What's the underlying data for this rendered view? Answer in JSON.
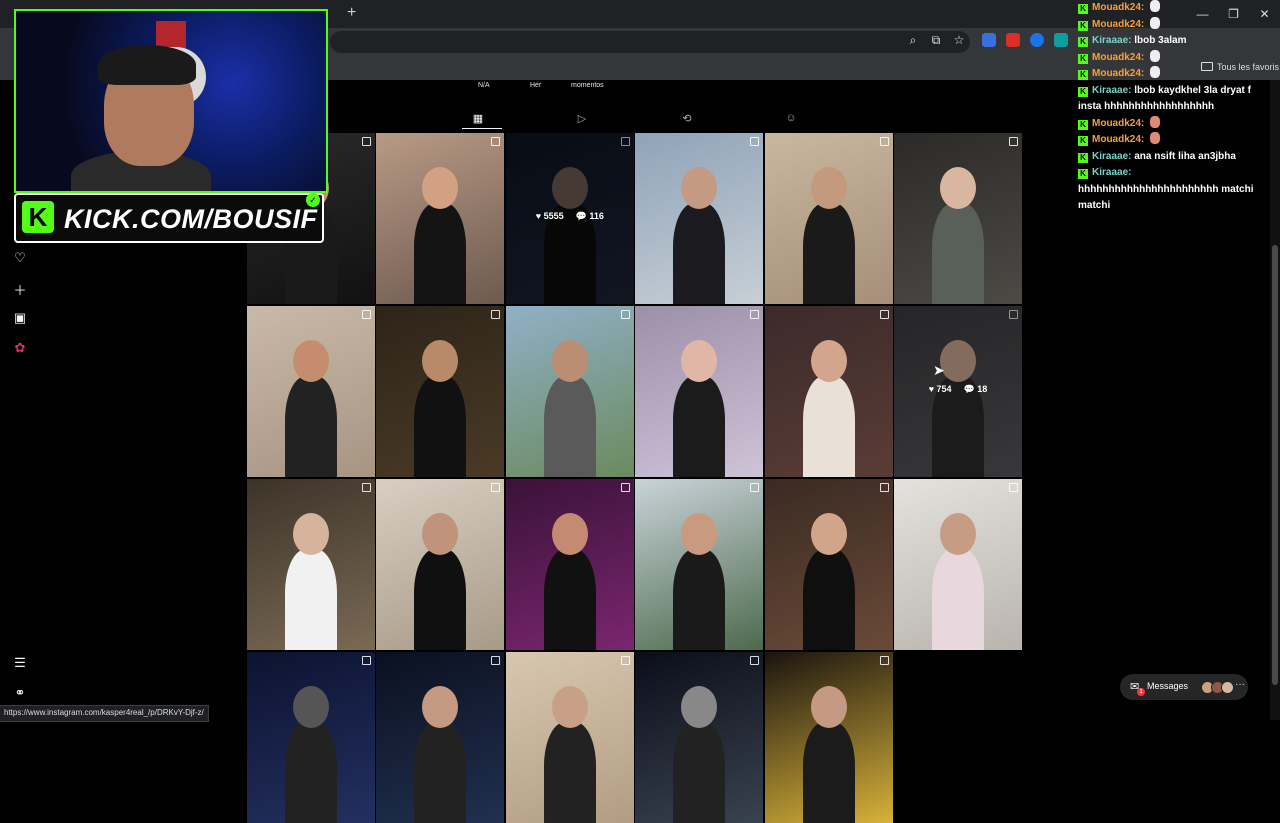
{
  "browser": {
    "tab_close": "×",
    "new_tab": "+",
    "window_controls": [
      "—",
      "❐",
      "✕"
    ],
    "bookmark_folder": "Tous les favoris",
    "extension_icons": [
      "blue",
      "red",
      "blue-circle",
      "teal"
    ]
  },
  "profile": {
    "highlights": [
      "N/A",
      "Her",
      "momentos"
    ],
    "tabs": [
      "grid-icon",
      "reels-icon",
      "reposts-icon",
      "tagged-icon"
    ],
    "active_tab": "grid-icon"
  },
  "posts": [
    {
      "stats": null
    },
    {
      "stats": null
    },
    {
      "stats": {
        "likes": "5555",
        "comments": "116"
      }
    },
    {
      "stats": null
    },
    {
      "stats": null
    },
    {
      "stats": null
    },
    {
      "stats": null
    },
    {
      "stats": null
    },
    {
      "stats": null
    },
    {
      "stats": null
    },
    {
      "stats": null
    },
    {
      "stats": {
        "likes": "754",
        "comments": "18"
      }
    },
    {
      "stats": null
    },
    {
      "stats": null
    },
    {
      "stats": null
    },
    {
      "stats": null
    },
    {
      "stats": null
    },
    {
      "stats": null
    },
    {
      "stats": null
    },
    {
      "stats": null
    },
    {
      "stats": null
    },
    {
      "stats": null
    },
    {
      "stats": null
    }
  ],
  "messages_button": {
    "label": "Messages",
    "badge": "1"
  },
  "status_url": "https://www.instagram.com/kasper4real_/p/DRKvY-Djf-z/",
  "overlay": {
    "banner_text": "KICK.COM/BOUSIF",
    "chat": [
      {
        "user": "Mouadk24",
        "color": "orange",
        "text": "",
        "emote": "white"
      },
      {
        "user": "Mouadk24",
        "color": "orange",
        "text": "",
        "emote": "white"
      },
      {
        "user": "Kiraaae",
        "color": "teal",
        "text": "lbob 3alam",
        "emote": ""
      },
      {
        "user": "Mouadk24",
        "color": "orange",
        "text": "",
        "emote": "white"
      },
      {
        "user": "Mouadk24",
        "color": "orange",
        "text": "",
        "emote": "white"
      },
      {
        "user": "Kiraaae",
        "color": "teal",
        "text": "lbob kaydkhel 3la dryat f insta hhhhhhhhhhhhhhhhhh",
        "emote": ""
      },
      {
        "user": "Mouadk24",
        "color": "orange",
        "text": "",
        "emote": "red"
      },
      {
        "user": "Mouadk24",
        "color": "orange",
        "text": "",
        "emote": "red"
      },
      {
        "user": "Kiraaae",
        "color": "teal",
        "text": "ana nsift liha an3jbha",
        "emote": ""
      },
      {
        "user": "Kiraaae",
        "color": "teal",
        "text": "hhhhhhhhhhhhhhhhhhhhhhh matchi matchi",
        "emote": ""
      }
    ]
  }
}
